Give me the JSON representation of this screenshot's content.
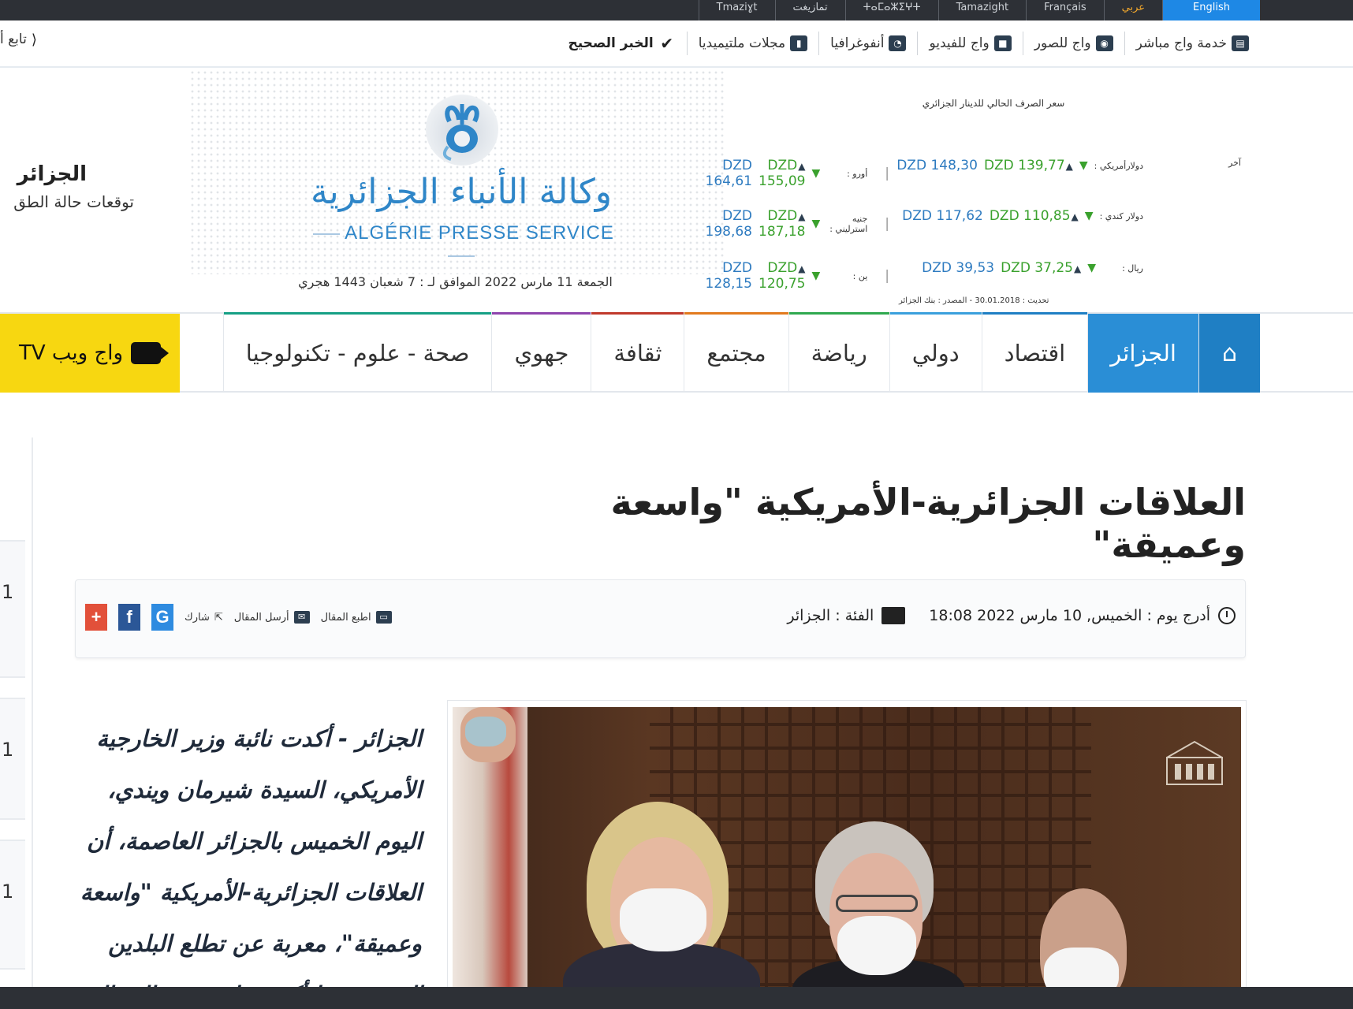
{
  "topbar": {
    "languages": [
      {
        "label": "English",
        "state": "active"
      },
      {
        "label": "عربي",
        "state": "current"
      },
      {
        "label": "Français",
        "state": ""
      },
      {
        "label": "Tamazight",
        "state": ""
      },
      {
        "label": "ⵜⴰⵎⴰⵣⵉⵖⵜ",
        "state": ""
      },
      {
        "label": "تمازيغت",
        "state": ""
      },
      {
        "label": "Tmaziɣt",
        "state": ""
      }
    ]
  },
  "services": {
    "items": [
      {
        "label": "خدمة واج مباشر",
        "icon": "newspaper-icon"
      },
      {
        "label": "واج للصور",
        "icon": "camera-icon"
      },
      {
        "label": "واج للفيديو",
        "icon": "video-camera-icon"
      },
      {
        "label": "أنفوغرافيا",
        "icon": "pie-chart-icon"
      },
      {
        "label": "مجلات ملتيميديا",
        "icon": "book-icon"
      },
      {
        "label": "الخبر الصحيح",
        "icon": "check-icon"
      }
    ],
    "follow_label": "تابع أ"
  },
  "header": {
    "logo_ar": "وكالة الأنباء الجزائرية",
    "logo_fr": "ALGÉRIE PRESSE SERVICE",
    "date_line": "الجمعة 11 مارس 2022 الموافق لـ : 7 شعبان 1443 هجري",
    "rates_title": "سعر الصرف الحالي للدينار الجزائري",
    "rates_last_label": "آخر",
    "rates_update": "تحديث : 30.01.2018 - المصدر : بنك الجزائر",
    "rates": [
      {
        "name": "دولارأمريكي :",
        "buy": "DZD 139,77",
        "sell": "DZD 148,30"
      },
      {
        "name": "أورو :",
        "buy": "DZD 155,09",
        "sell": "DZD 164,61"
      },
      {
        "name": "دولار كندي :",
        "buy": "DZD 110,85",
        "sell": "DZD 117,62"
      },
      {
        "name": "جنيه استرليني :",
        "buy": "DZD 187,18",
        "sell": "DZD 198,68"
      },
      {
        "name": "ريال :",
        "buy": "DZD 37,25",
        "sell": "DZD 39,53"
      },
      {
        "name": "ين :",
        "buy": "DZD 120,75",
        "sell": "DZD 128,15"
      }
    ],
    "weather_city": "الجزائر",
    "weather_desc": "توقعات حالة الطق"
  },
  "nav": {
    "items": [
      {
        "label": "الجزائر",
        "active": true,
        "color": "#2a8ed6"
      },
      {
        "label": "اقتصاد",
        "color": "#1f7fc4"
      },
      {
        "label": "دولي",
        "color": "#3aa0dd"
      },
      {
        "label": "رياضة",
        "color": "#2fa84f"
      },
      {
        "label": "مجتمع",
        "color": "#e27a1e"
      },
      {
        "label": "ثقافة",
        "color": "#c0392b"
      },
      {
        "label": "جهوي",
        "color": "#8e44ad"
      },
      {
        "label": "صحة - علوم - تكنولوجيا",
        "color": "#16a085"
      }
    ],
    "tv_label": "واج ويب TV"
  },
  "sidebar": {
    "items": [
      "1",
      "1",
      "1"
    ]
  },
  "article": {
    "title": "العلاقات الجزائرية-الأمريكية \"واسعة وعميقة\"",
    "posted_label": "أدرج يوم : الخميس, 10 مارس 2022 18:08",
    "category_label": "الفئة : الجزائر",
    "print_label": "اطبع المقال",
    "send_label": "أرسل المقال",
    "share_label": "شارك",
    "lead": "الجزائر - أكدت نائبة وزير الخارجية الأمريكي، السيدة شيرمان ويندي، اليوم الخميس بالجزائر العاصمة، أن العلاقات الجزائرية-الأمريكية \"واسعة وعميقة\"، معربة عن تطلع البلدين إلى تعزيزها أكثر، خاصة في المجال"
  }
}
